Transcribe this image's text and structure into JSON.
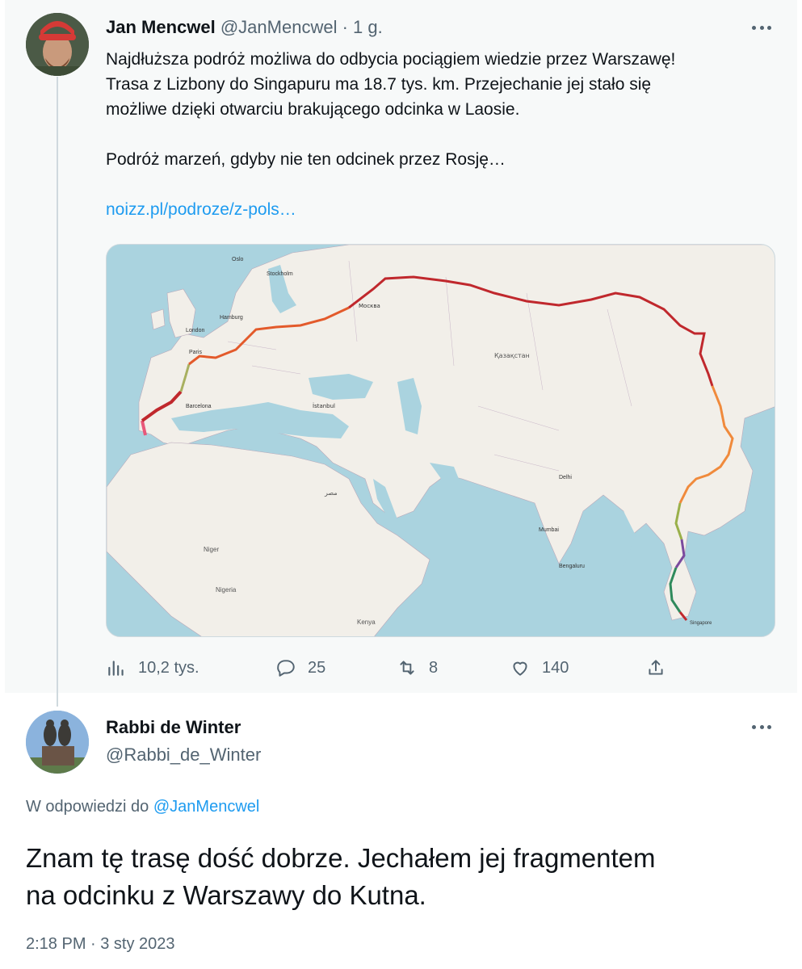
{
  "parent_tweet": {
    "author_name": "Jan Mencwel",
    "author_handle": "@JanMencwel",
    "separator": "·",
    "time_ago": "1 g.",
    "text_line1": "Najdłuższa podróż możliwa do odbycia pociągiem wiedzie przez Warszawę!",
    "text_line2": "Trasa z Lizbony do Singapuru  ma 18.7 tys. km. Przejechanie jej stało się",
    "text_line3": "możliwe dzięki otwarciu brakującego odcinka w Laosie.",
    "text_line4": "Podróż marzeń, gdyby nie ten odcinek przez Rosję…",
    "link_text": "noizz.pl/podroze/z-pols…",
    "map_labels": {
      "oslo": "Oslo",
      "stockholm": "Stockholm",
      "london": "London",
      "paris": "Paris",
      "hamburg": "Hamburg",
      "moskva": "Москва",
      "barcelona": "Barcelona",
      "istanbul": "İstanbul",
      "kazakhstan": "Қазақстан",
      "delhi": "Delhi",
      "mumbai": "Mumbai",
      "bangalore": "Bengaluru",
      "niger": "Niger",
      "nigeria": "Nigeria",
      "kenya": "Kenya",
      "singapore": "Singapore",
      "misr": "مصر"
    },
    "stats": {
      "views": "10,2 tys.",
      "replies": "25",
      "retweets": "8",
      "likes": "140"
    }
  },
  "reply_tweet": {
    "author_name": "Rabbi de Winter",
    "author_handle": "@Rabbi_de_Winter",
    "reply_prefix": "W odpowiedzi do",
    "reply_to_handle": "@JanMencwel",
    "text_line1": "Znam tę trasę dość dobrze. Jechałem jej fragmentem",
    "text_line2": "na odcinku z Warszawy do Kutna.",
    "timestamp": "2:18 PM · 3 sty 2023"
  },
  "colors": {
    "link": "#1d9bf0",
    "secondary_text": "#536471",
    "parent_background": "#f7f9f9",
    "route_west": "#e35a2b",
    "route_russia": "#c0282d",
    "route_asia": "#f08a3c",
    "route_laos": "#9ab04a",
    "route_thailand": "#7b4a9e",
    "route_malaysia": "#2f8a5c"
  }
}
